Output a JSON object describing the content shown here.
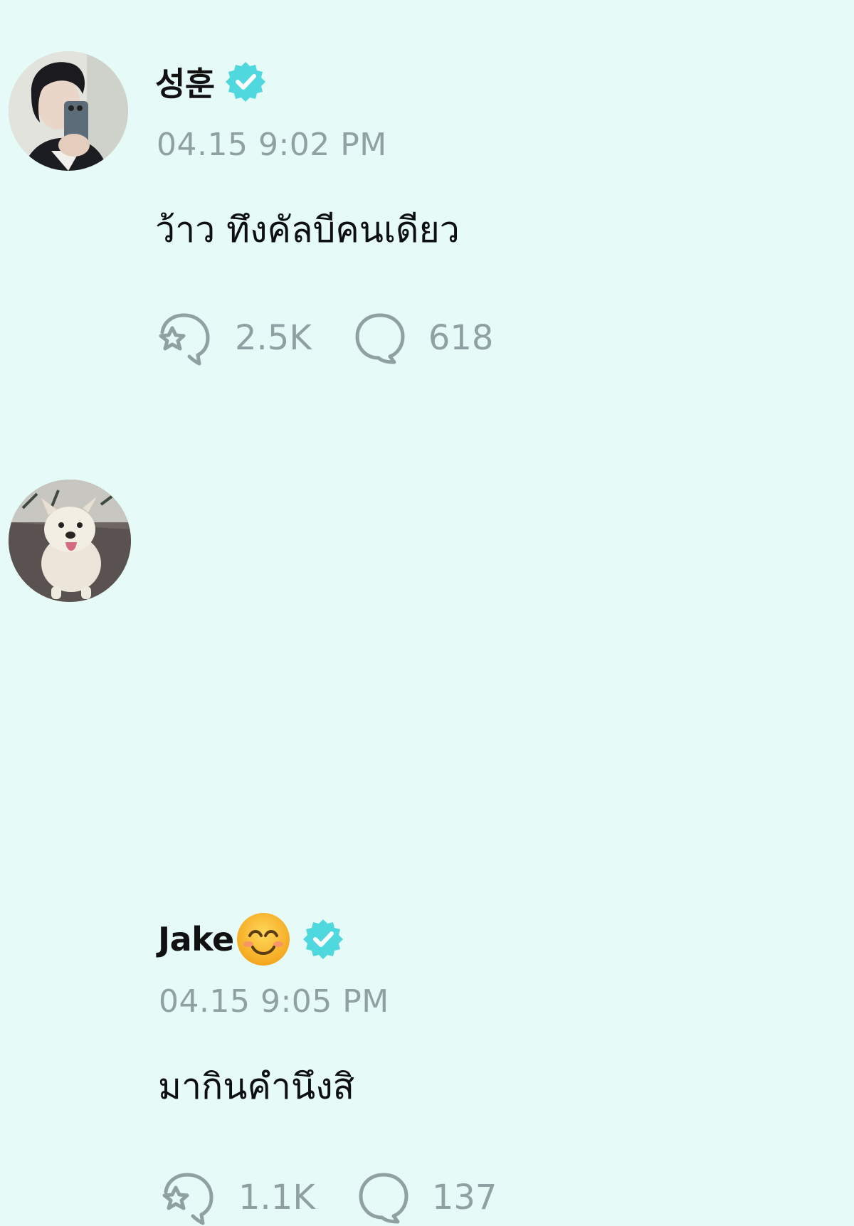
{
  "posts": [
    {
      "author": "성훈",
      "verified": true,
      "timestamp": "04.15 9:02 PM",
      "text": "ว้าว ทึงคัลบีคนเดียว",
      "likes": "2.5K",
      "replies": "618"
    },
    {
      "author": "Jake",
      "verified": true,
      "timestamp": "04.15 9:05 PM",
      "text": "มากินคำนึงสิ",
      "likes": "1.1K",
      "replies": "137"
    }
  ],
  "colors": {
    "background": "#e6fbf8",
    "verified_badge": "#4fd8dd",
    "muted_text": "#8fa1a3",
    "icon_stroke": "#8fa1a3"
  },
  "icons": {
    "like": "star-bubble-icon",
    "reply": "speech-bubble-icon",
    "verified": "verified-badge-icon",
    "emoji": "smiling-face-emoji"
  }
}
